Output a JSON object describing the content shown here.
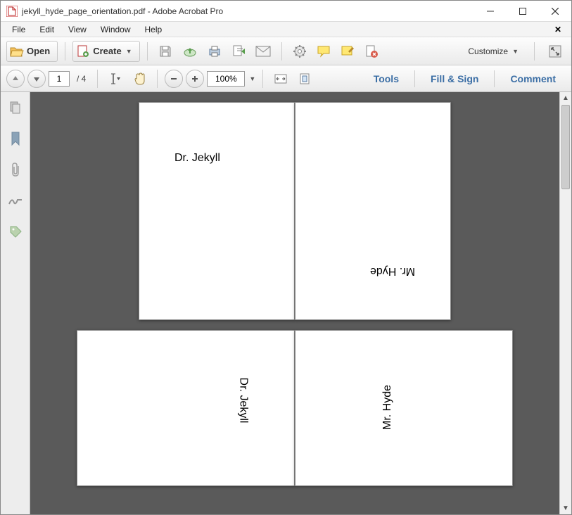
{
  "window": {
    "title": "jekyll_hyde_page_orientation.pdf - Adobe Acrobat Pro"
  },
  "menu": {
    "file": "File",
    "edit": "Edit",
    "view": "View",
    "window": "Window",
    "help": "Help"
  },
  "toolbar": {
    "open": "Open",
    "create": "Create",
    "customize": "Customize"
  },
  "nav": {
    "page_current": "1",
    "page_total": "/ 4",
    "zoom": "100%"
  },
  "right_tools": {
    "tools": "Tools",
    "fill_sign": "Fill & Sign",
    "comment": "Comment"
  },
  "pages": {
    "p1": "Dr. Jekyll",
    "p2": "Mr. Hyde",
    "p3": "Dr. Jekyll",
    "p4": "Mr. Hyde"
  }
}
